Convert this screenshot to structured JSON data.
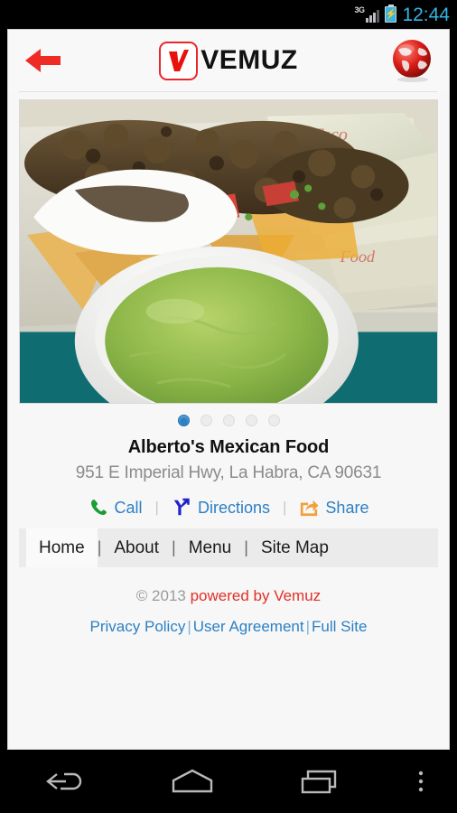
{
  "statusbar": {
    "network_label": "3G",
    "battery_icon": "battery-charging-icon",
    "signal_icon": "signal-bars-icon",
    "time": "12:44"
  },
  "appbar": {
    "back_icon": "back-arrow-icon",
    "logo_icon": "vemuz-checkmark-logo-icon",
    "brand": "VEMUZ",
    "globe_icon": "globe-icon"
  },
  "carousel": {
    "image_alt": "mexican-food-nachos-guacamole",
    "dots_total": 5,
    "active_dot": 1
  },
  "business": {
    "name": "Alberto's Mexican Food",
    "address": "951 E Imperial Hwy, La Habra, CA 90631"
  },
  "actions": [
    {
      "label": "Call",
      "icon": "phone-icon",
      "color": "#1a9d34"
    },
    {
      "label": "Directions",
      "icon": "directions-fork-icon",
      "color": "#2222cc"
    },
    {
      "label": "Share",
      "icon": "share-export-icon",
      "color": "#f0a13c"
    }
  ],
  "action_separator": "|",
  "nav_tabs": [
    {
      "label": "Home",
      "active": true
    },
    {
      "label": "About",
      "active": false
    },
    {
      "label": "Menu",
      "active": false
    },
    {
      "label": "Site Map",
      "active": false
    }
  ],
  "tab_separator": "|",
  "footer": {
    "copyright": "© 2013 ",
    "powered_by": "powered by Vemuz",
    "links": [
      {
        "label": "Privacy Policy"
      },
      {
        "label": "User Agreement"
      },
      {
        "label": "Full Site"
      }
    ],
    "link_separator": "|"
  },
  "android_navbar": {
    "back": "android-back-icon",
    "home": "android-home-icon",
    "recents": "android-recents-icon",
    "menu": "android-overflow-menu-icon"
  },
  "colors": {
    "accent_blue": "#2c7fc4",
    "brand_red": "#e8272c",
    "status_blue": "#33b5e5",
    "page_bg": "#f7f7f7",
    "tabbar_bg": "#ebebeb"
  }
}
